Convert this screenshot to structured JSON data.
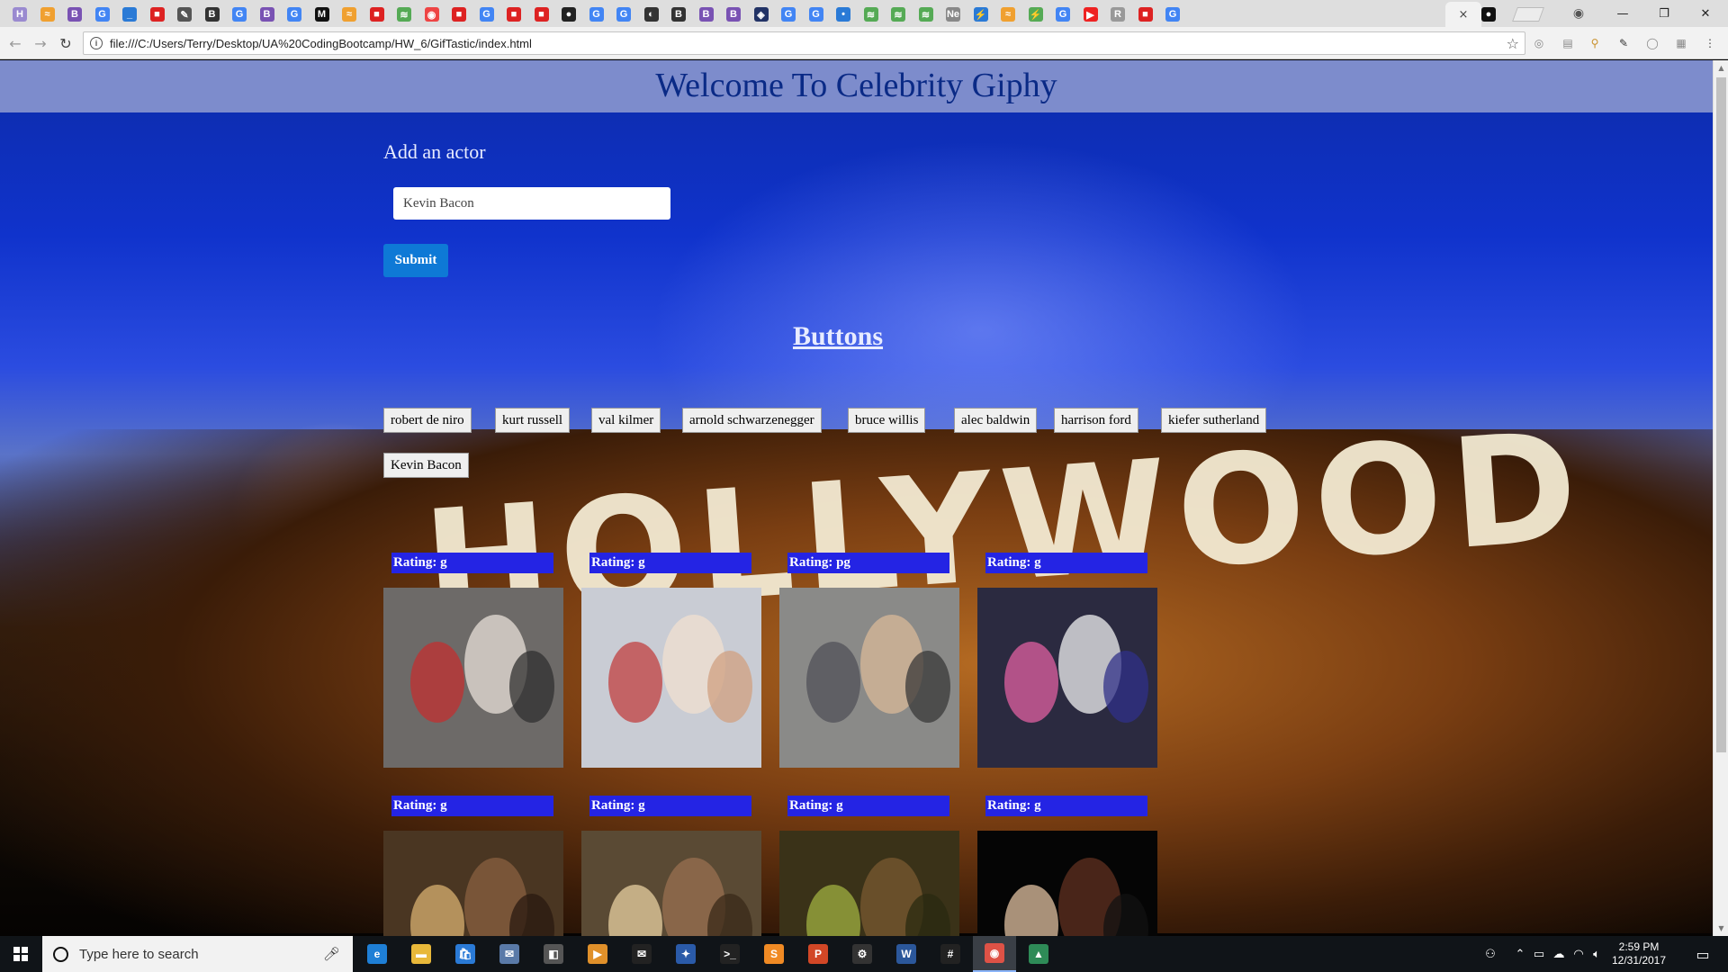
{
  "browser": {
    "url": "file:///C:/Users/Terry/Desktop/UA%20CodingBootcamp/HW_6/GifTastic/index.html",
    "tabs": [
      {
        "icon": "H",
        "color": "#9a8ad0"
      },
      {
        "icon": "≈",
        "color": "#f0a030"
      },
      {
        "icon": "B",
        "color": "#7952b3"
      },
      {
        "icon": "G",
        "color": "#4285f4"
      },
      {
        "icon": "_",
        "color": "#2a7ad6"
      },
      {
        "icon": "■",
        "color": "#d22"
      },
      {
        "icon": "✎",
        "color": "#555"
      },
      {
        "icon": "B",
        "color": "#333"
      },
      {
        "icon": "G",
        "color": "#4285f4"
      },
      {
        "icon": "B",
        "color": "#7952b3"
      },
      {
        "icon": "G",
        "color": "#4285f4"
      },
      {
        "icon": "M",
        "color": "#111"
      },
      {
        "icon": "≈",
        "color": "#f0a030"
      },
      {
        "icon": "■",
        "color": "#d22"
      },
      {
        "icon": "≋",
        "color": "#5a5"
      },
      {
        "icon": "◉",
        "color": "#e44"
      },
      {
        "icon": "■",
        "color": "#d22"
      },
      {
        "icon": "G",
        "color": "#4285f4"
      },
      {
        "icon": "■",
        "color": "#d22"
      },
      {
        "icon": "■",
        "color": "#d22"
      },
      {
        "icon": "●",
        "color": "#222"
      },
      {
        "icon": "G",
        "color": "#4285f4"
      },
      {
        "icon": "G",
        "color": "#4285f4"
      },
      {
        "icon": "◐",
        "color": "#333"
      },
      {
        "icon": "B",
        "color": "#333"
      },
      {
        "icon": "B",
        "color": "#7952b3"
      },
      {
        "icon": "B",
        "color": "#7952b3"
      },
      {
        "icon": "◈",
        "color": "#236"
      },
      {
        "icon": "G",
        "color": "#4285f4"
      },
      {
        "icon": "G",
        "color": "#4285f4"
      },
      {
        "icon": "•",
        "color": "#2a7ad6"
      },
      {
        "icon": "≋",
        "color": "#5a5"
      },
      {
        "icon": "≋",
        "color": "#5a5"
      },
      {
        "icon": "≋",
        "color": "#5a5"
      },
      {
        "icon": "Ne",
        "color": "#888"
      },
      {
        "icon": "⚡",
        "color": "#2a7ad6"
      },
      {
        "icon": "≈",
        "color": "#f0a030"
      },
      {
        "icon": "⚡",
        "color": "#5a5"
      },
      {
        "icon": "G",
        "color": "#4285f4"
      },
      {
        "icon": "▶",
        "color": "#e22"
      },
      {
        "icon": "R",
        "color": "#999"
      },
      {
        "icon": "■",
        "color": "#d22"
      },
      {
        "icon": "G",
        "color": "#4285f4"
      }
    ],
    "active_tab_close": "×",
    "github_icon": "●"
  },
  "page": {
    "title": "Welcome To Celebrity Giphy",
    "add_label": "Add an actor",
    "input_value": "Kevin Bacon",
    "submit_label": "Submit",
    "buttons_title": "Buttons",
    "actor_buttons": [
      "robert de niro",
      "kurt russell",
      "val kilmer",
      "arnold schwarzenegger",
      "bruce willis",
      "alec baldwin",
      "harrison ford",
      "kiefer sutherland",
      "Kevin Bacon"
    ],
    "gifs_row1": [
      {
        "rating": "Rating: g",
        "bg": "#6d6a68"
      },
      {
        "rating": "Rating: g",
        "bg": "#c9ccd4"
      },
      {
        "rating": "Rating: pg",
        "bg": "#8a8a88"
      },
      {
        "rating": "Rating: g",
        "bg": "#2b2a40"
      }
    ],
    "gifs_row2": [
      {
        "rating": "Rating: g",
        "bg": "#4a3622"
      },
      {
        "rating": "Rating: g",
        "bg": "#5a4a34"
      },
      {
        "rating": "Rating: g",
        "bg": "#3a3218"
      },
      {
        "rating": "Rating: g",
        "bg": "#050505"
      }
    ],
    "hollywood_sign": "HOLLYWOOD"
  },
  "taskbar": {
    "search_placeholder": "Type here to search",
    "apps": [
      {
        "name": "edge",
        "icon": "e",
        "color": "#1e7fd6"
      },
      {
        "name": "file-explorer",
        "icon": "▬",
        "color": "#e8b83a"
      },
      {
        "name": "store",
        "icon": "🛍",
        "color": "#2a7ad6"
      },
      {
        "name": "app-badge",
        "icon": "✉",
        "color": "#5a7aa8"
      },
      {
        "name": "app-dark",
        "icon": "◧",
        "color": "#555"
      },
      {
        "name": "media",
        "icon": "▶",
        "color": "#e0902a"
      },
      {
        "name": "mail",
        "icon": "✉",
        "color": "#222"
      },
      {
        "name": "app-blue",
        "icon": "✦",
        "color": "#2a5aa8"
      },
      {
        "name": "terminal",
        "icon": ">_",
        "color": "#222"
      },
      {
        "name": "sublime",
        "icon": "S",
        "color": "#f08a24"
      },
      {
        "name": "powerpoint",
        "icon": "P",
        "color": "#d24726"
      },
      {
        "name": "settings",
        "icon": "⚙",
        "color": "#333"
      },
      {
        "name": "word",
        "icon": "W",
        "color": "#2b579a"
      },
      {
        "name": "slack",
        "icon": "#",
        "color": "#222"
      },
      {
        "name": "chrome",
        "icon": "◉",
        "color": "#de5246"
      },
      {
        "name": "app-green",
        "icon": "▲",
        "color": "#2e8b57"
      }
    ],
    "time": "2:59 PM",
    "date": "12/31/2017"
  }
}
